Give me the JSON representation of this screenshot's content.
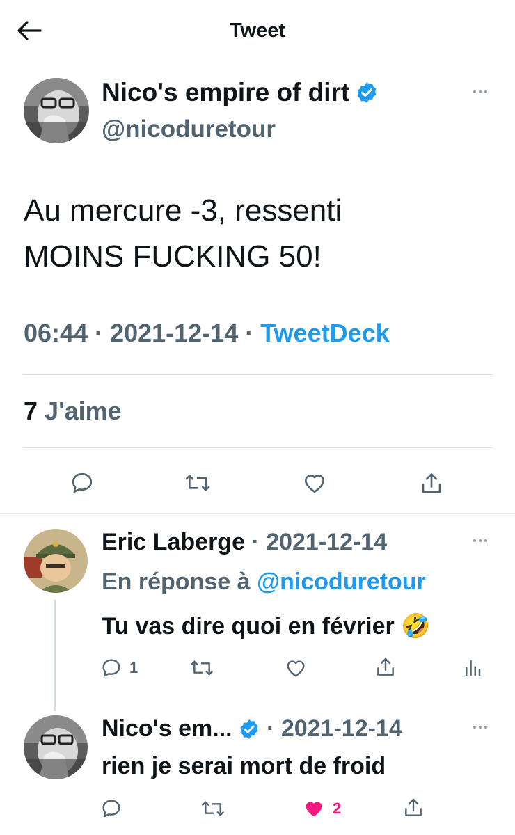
{
  "header": {
    "title": "Tweet",
    "back_icon": "arrow-left-icon"
  },
  "tweet": {
    "author_name": "Nico's empire of dirt",
    "handle": "@nicoduretour",
    "text_line1": "Au mercure -3, ressenti",
    "text_line2": "MOINS FUCKING 50!",
    "time": "06:44",
    "date": "2021-12-14",
    "source": "TweetDeck",
    "sep": " · ",
    "likes_count": "7",
    "likes_label": "J'aime"
  },
  "replies": [
    {
      "author_name": "Eric Laberge",
      "date": "2021-12-14",
      "reply_prefix": "En réponse à",
      "reply_to": "@nicoduretour",
      "text": "Tu vas dire quoi en février",
      "emoji": "🤣",
      "reply_count": "1"
    },
    {
      "author_name": "Nico's em...",
      "date": "2021-12-14",
      "text": "rien je serai mort de froid",
      "like_count": "2"
    }
  ],
  "colors": {
    "accent": "#1d9bf0",
    "like": "#f91880",
    "muted": "#536471"
  }
}
